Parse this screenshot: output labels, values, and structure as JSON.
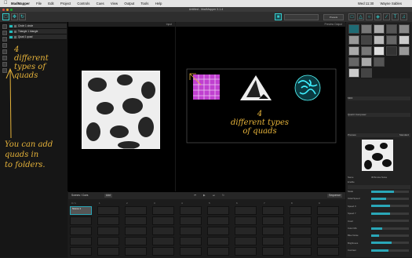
{
  "menubar": {
    "apple_icon": "apple-icon",
    "items": [
      "MadMapper",
      "File",
      "Edit",
      "Project",
      "Controls",
      "Cues",
      "View",
      "Output",
      "Tools",
      "Help"
    ],
    "clock": "Wed 11:30",
    "user": "Wayne Sables"
  },
  "window": {
    "title": "Untitled - MadMapper 3.1.4"
  },
  "toolbar": {
    "dropdown_label": "Presets",
    "search_placeholder": ""
  },
  "layers": [
    {
      "label": "Circle 1 circle"
    },
    {
      "label": "Triangle 1 triangle"
    },
    {
      "label": "Quad 1 quad"
    }
  ],
  "annotations": {
    "left_note": "4\ndifferent\ntypes of\nquads",
    "left_note2": "You can add\nquads in\nto folders.",
    "right_note": "4\ndifferent types\nof quads"
  },
  "views": {
    "input_label": "Input",
    "output_label": "Preview Output"
  },
  "rightpanel": {
    "sections": [
      "Quartz Composer",
      "Preview",
      "MIDI"
    ],
    "preview_mode": "Standard",
    "name_label": "Name",
    "name_value": "3DSmoke Noise",
    "enabled_label": "Enable",
    "props": [
      "Scale",
      "Initial Speed",
      "Speed X",
      "Speed Y",
      "Invert",
      "Color Mix",
      "Blue Noise",
      "Brightness",
      "Contrast"
    ],
    "bar_values": [
      0.6,
      0.4,
      0.5,
      0.5,
      0,
      0.3,
      0.2,
      0.55,
      0.45
    ]
  },
  "timeline": {
    "title": "Scenes / Cues",
    "add_button": "Add",
    "scene_label": "Scene 1",
    "scene_sub": "Scene 1",
    "sequence_label": "Sequence",
    "cols": [
      "0 / 1",
      "1",
      "2",
      "3",
      "4",
      "5",
      "6",
      "7",
      "8",
      "9"
    ]
  }
}
